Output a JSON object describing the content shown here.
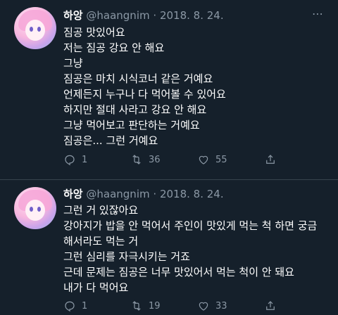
{
  "tweets": [
    {
      "name": "하앙",
      "handle": "@haangnim",
      "date": "2018. 8. 24.",
      "menu_icon": "more-dots-icon",
      "lines": [
        "짐공 맛있어요",
        "저는 짐공 강요 안 해요",
        "그냥",
        "짐공은 마치 시식코너 같은 거예요",
        "언제든지 누구나 다 먹어볼 수 있어요",
        "하지만 절대 사라고 강요 안 해요",
        "그냥 먹어보고 판단하는 거예요",
        "짐공은... 그런 거예요"
      ],
      "replies": "1",
      "retweets": "36",
      "likes": "55"
    },
    {
      "name": "하앙",
      "handle": "@haangnim",
      "date": "2018. 8. 24.",
      "lines": [
        "그런 거 있잖아요",
        "강아지가 밥을 안 먹어서 주인이 맛있게 먹는 척 하면 궁금",
        "해서라도 먹는 거",
        "그런 심리를 자극시키는 거죠",
        "근데 문제는 짐공은 너무 맛있어서 먹는 척이 안 돼요",
        "내가 다 먹어요"
      ],
      "replies": "1",
      "retweets": "19",
      "likes": "33"
    }
  ],
  "colors": {
    "background": "#15202b",
    "text": "#ffffff",
    "muted": "#8b98a5",
    "divider": "#38444d"
  }
}
